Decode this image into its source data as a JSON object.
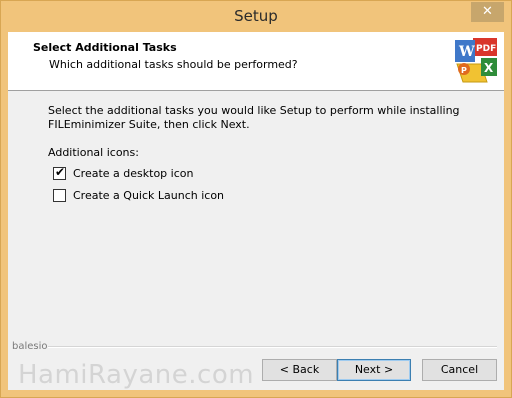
{
  "window": {
    "title": "Setup",
    "close_glyph": "✕"
  },
  "header": {
    "title": "Select Additional Tasks",
    "subtitle": "Which additional tasks should be performed?",
    "logo_icon": "office-documents-icon"
  },
  "main": {
    "description": "Select the additional tasks you would like Setup to perform while installing FILEminimizer Suite, then click Next.",
    "section_label": "Additional icons:",
    "tasks": [
      {
        "label": "Create a desktop icon",
        "checked": true
      },
      {
        "label": "Create a Quick Launch icon",
        "checked": false
      }
    ]
  },
  "footer": {
    "brand": "balesio",
    "watermark": "HamiRayane.com",
    "back_label": "< Back",
    "next_label": "Next >",
    "cancel_label": "Cancel"
  },
  "colors": {
    "frame": "#f1c47b",
    "client_bg": "#f0f0f0",
    "default_button_border": "#3c7fb1"
  }
}
